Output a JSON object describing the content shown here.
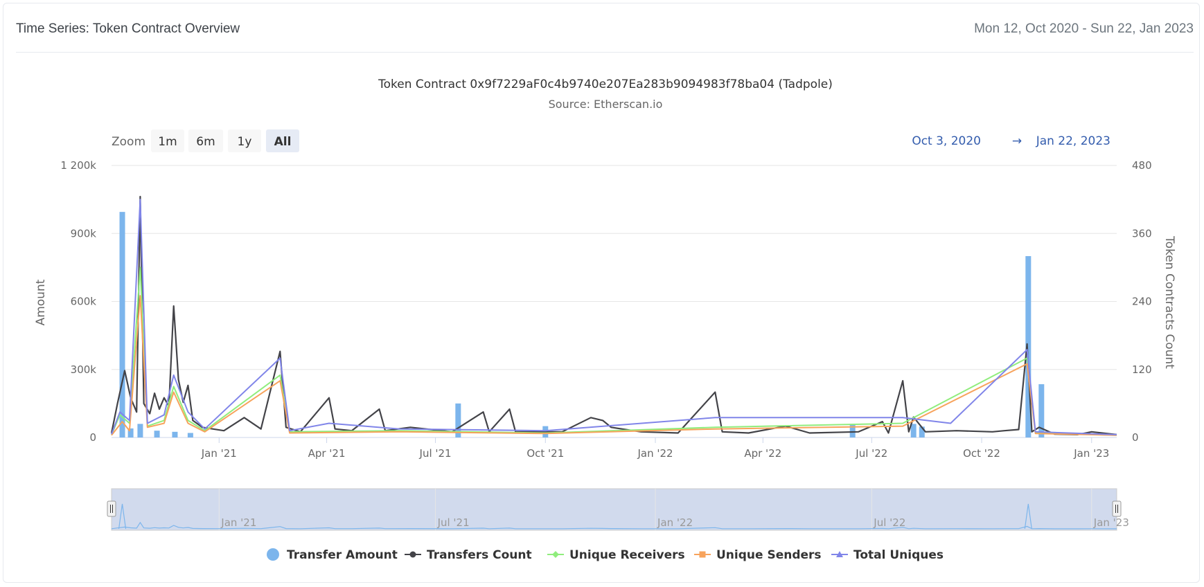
{
  "header": {
    "title": "Time Series: Token Contract Overview",
    "date_range": "Mon 12, Oct 2020 - Sun 22, Jan 2023"
  },
  "range_selector": {
    "zoom_label": "Zoom",
    "buttons": [
      "1m",
      "6m",
      "1y",
      "All"
    ],
    "selected": "All",
    "from_date": "Oct 3, 2020",
    "arrow": "→",
    "to_date": "Jan 22, 2023"
  },
  "colors": {
    "transfer_amount": "#7cb5ec",
    "transfers_count": "#434348",
    "unique_receivers": "#90ed7d",
    "unique_senders": "#f7a35c",
    "total_uniques": "#8085e9",
    "navigator_fill": "#ccd6eb",
    "navigator_line": "#7cb5ec"
  },
  "chart_data": {
    "type": "line",
    "title": "Token Contract 0x9f7229aF0c4b9740e207Ea283b9094983f78ba04 (Tadpole)",
    "subtitle": "Source: Etherscan.io",
    "xlabel": "",
    "ylabel_left": "Amount",
    "ylabel_right": "Token Contracts Count",
    "x_range": [
      "2020-10-03",
      "2023-01-22"
    ],
    "y_left_range": [
      0,
      1200000
    ],
    "y_right_range": [
      0,
      480
    ],
    "y_left_ticks": [
      "0",
      "300k",
      "600k",
      "900k",
      "1 200k"
    ],
    "y_right_ticks": [
      "0",
      "120",
      "240",
      "360",
      "480"
    ],
    "x_ticks": [
      "Jan '21",
      "Apr '21",
      "Jul '21",
      "Oct '21",
      "Jan '22",
      "Apr '22",
      "Jul '22",
      "Oct '22",
      "Jan '23"
    ],
    "x_tick_dates": [
      "2021-01-01",
      "2021-04-01",
      "2021-07-01",
      "2021-10-01",
      "2022-01-01",
      "2022-04-01",
      "2022-07-01",
      "2022-10-01",
      "2023-01-01"
    ],
    "navigator_ticks": [
      "Jan '21",
      "Jul '21",
      "Jan '22",
      "Jul '22",
      "Jan '23"
    ],
    "navigator_tick_dates": [
      "2021-01-01",
      "2021-07-01",
      "2022-01-01",
      "2022-07-01",
      "2023-01-01"
    ],
    "legend": "bottom-center",
    "grid": true,
    "series": [
      {
        "name": "Transfer Amount",
        "type": "column",
        "axis": "left",
        "points": [
          [
            "2020-10-12",
            995000
          ],
          [
            "2020-10-19",
            40000
          ],
          [
            "2020-10-27",
            60000
          ],
          [
            "2020-11-10",
            30000
          ],
          [
            "2020-11-25",
            25000
          ],
          [
            "2020-12-08",
            20000
          ],
          [
            "2021-07-20",
            150000
          ],
          [
            "2021-10-01",
            50000
          ],
          [
            "2022-06-15",
            60000
          ],
          [
            "2022-08-05",
            60000
          ],
          [
            "2022-08-12",
            48000
          ],
          [
            "2022-11-09",
            800000
          ],
          [
            "2022-11-20",
            235000
          ]
        ]
      },
      {
        "name": "Transfers Count",
        "type": "line",
        "axis": "right",
        "points": [
          [
            "2020-10-03",
            8
          ],
          [
            "2020-10-08",
            60
          ],
          [
            "2020-10-14",
            118
          ],
          [
            "2020-10-19",
            70
          ],
          [
            "2020-10-24",
            45
          ],
          [
            "2020-10-27",
            425
          ],
          [
            "2020-10-30",
            60
          ],
          [
            "2020-11-04",
            42
          ],
          [
            "2020-11-08",
            78
          ],
          [
            "2020-11-12",
            50
          ],
          [
            "2020-11-16",
            70
          ],
          [
            "2020-11-20",
            55
          ],
          [
            "2020-11-24",
            232
          ],
          [
            "2020-11-28",
            102
          ],
          [
            "2020-12-02",
            62
          ],
          [
            "2020-12-06",
            92
          ],
          [
            "2020-12-10",
            30
          ],
          [
            "2020-12-18",
            18
          ],
          [
            "2021-01-05",
            12
          ],
          [
            "2021-01-22",
            35
          ],
          [
            "2021-02-05",
            15
          ],
          [
            "2021-02-21",
            152
          ],
          [
            "2021-02-26",
            18
          ],
          [
            "2021-03-10",
            10
          ],
          [
            "2021-04-03",
            70
          ],
          [
            "2021-04-08",
            15
          ],
          [
            "2021-04-22",
            12
          ],
          [
            "2021-05-15",
            50
          ],
          [
            "2021-05-20",
            12
          ],
          [
            "2021-06-10",
            18
          ],
          [
            "2021-07-15",
            10
          ],
          [
            "2021-08-10",
            45
          ],
          [
            "2021-08-15",
            10
          ],
          [
            "2021-09-01",
            50
          ],
          [
            "2021-09-06",
            10
          ],
          [
            "2021-10-15",
            10
          ],
          [
            "2021-11-08",
            35
          ],
          [
            "2021-11-18",
            30
          ],
          [
            "2021-11-25",
            18
          ],
          [
            "2021-12-20",
            10
          ],
          [
            "2022-01-20",
            8
          ],
          [
            "2022-02-20",
            80
          ],
          [
            "2022-02-26",
            10
          ],
          [
            "2022-03-20",
            8
          ],
          [
            "2022-04-20",
            20
          ],
          [
            "2022-05-10",
            8
          ],
          [
            "2022-06-20",
            10
          ],
          [
            "2022-07-10",
            28
          ],
          [
            "2022-07-15",
            8
          ],
          [
            "2022-07-27",
            100
          ],
          [
            "2022-08-01",
            10
          ],
          [
            "2022-08-05",
            36
          ],
          [
            "2022-08-15",
            10
          ],
          [
            "2022-09-10",
            12
          ],
          [
            "2022-10-10",
            10
          ],
          [
            "2022-10-20",
            12
          ],
          [
            "2022-11-01",
            14
          ],
          [
            "2022-11-08",
            165
          ],
          [
            "2022-11-12",
            10
          ],
          [
            "2022-11-18",
            18
          ],
          [
            "2022-12-01",
            6
          ],
          [
            "2022-12-20",
            5
          ],
          [
            "2023-01-01",
            10
          ],
          [
            "2023-01-22",
            5
          ]
        ]
      },
      {
        "name": "Unique Receivers",
        "type": "line",
        "axis": "right",
        "points": [
          [
            "2020-10-03",
            5
          ],
          [
            "2020-10-10",
            40
          ],
          [
            "2020-10-18",
            25
          ],
          [
            "2020-10-27",
            300
          ],
          [
            "2020-11-02",
            20
          ],
          [
            "2020-11-16",
            30
          ],
          [
            "2020-11-24",
            90
          ],
          [
            "2020-12-06",
            30
          ],
          [
            "2020-12-20",
            12
          ],
          [
            "2021-02-21",
            110
          ],
          [
            "2021-03-01",
            10
          ],
          [
            "2021-06-01",
            12
          ],
          [
            "2021-10-01",
            8
          ],
          [
            "2022-02-20",
            18
          ],
          [
            "2022-07-27",
            25
          ],
          [
            "2022-11-08",
            140
          ],
          [
            "2022-11-15",
            8
          ],
          [
            "2023-01-22",
            4
          ]
        ]
      },
      {
        "name": "Unique Senders",
        "type": "line",
        "axis": "right",
        "points": [
          [
            "2020-10-03",
            4
          ],
          [
            "2020-10-12",
            28
          ],
          [
            "2020-10-18",
            12
          ],
          [
            "2020-10-27",
            250
          ],
          [
            "2020-11-02",
            18
          ],
          [
            "2020-11-16",
            25
          ],
          [
            "2020-11-24",
            80
          ],
          [
            "2020-12-06",
            25
          ],
          [
            "2020-12-20",
            10
          ],
          [
            "2021-02-21",
            100
          ],
          [
            "2021-03-01",
            8
          ],
          [
            "2021-06-01",
            10
          ],
          [
            "2021-10-01",
            7
          ],
          [
            "2022-02-20",
            15
          ],
          [
            "2022-07-27",
            20
          ],
          [
            "2022-11-08",
            130
          ],
          [
            "2022-11-15",
            7
          ],
          [
            "2023-01-22",
            4
          ]
        ]
      },
      {
        "name": "Total Uniques",
        "type": "line",
        "axis": "right",
        "points": [
          [
            "2020-10-03",
            6
          ],
          [
            "2020-10-10",
            45
          ],
          [
            "2020-10-18",
            30
          ],
          [
            "2020-10-27",
            420
          ],
          [
            "2020-11-02",
            25
          ],
          [
            "2020-11-16",
            40
          ],
          [
            "2020-11-24",
            110
          ],
          [
            "2020-12-06",
            45
          ],
          [
            "2020-12-20",
            15
          ],
          [
            "2021-02-21",
            140
          ],
          [
            "2021-03-01",
            12
          ],
          [
            "2021-04-03",
            25
          ],
          [
            "2021-06-01",
            15
          ],
          [
            "2021-10-01",
            12
          ],
          [
            "2022-02-20",
            35
          ],
          [
            "2022-07-27",
            35
          ],
          [
            "2022-09-05",
            25
          ],
          [
            "2022-11-08",
            155
          ],
          [
            "2022-11-15",
            10
          ],
          [
            "2023-01-22",
            5
          ]
        ]
      }
    ]
  }
}
